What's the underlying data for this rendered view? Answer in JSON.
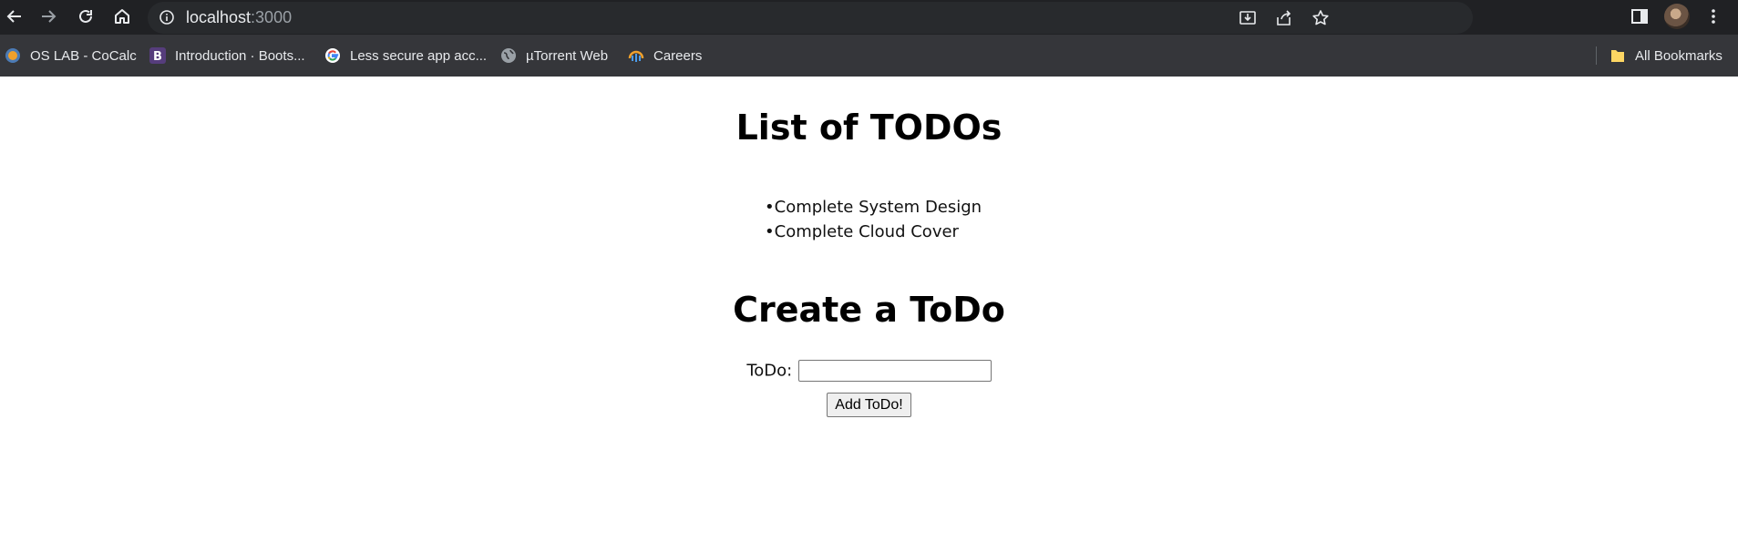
{
  "browser": {
    "url_host": "localhost",
    "url_port": ":3000",
    "bookmarks": [
      {
        "label": "OS LAB - CoCalc",
        "icon": "cocalc-icon"
      },
      {
        "label": "Introduction · Boots...",
        "icon": "bootstrap-icon"
      },
      {
        "label": "Less secure app acc...",
        "icon": "google-icon"
      },
      {
        "label": "µTorrent Web",
        "icon": "globe-icon"
      },
      {
        "label": "Careers",
        "icon": "careers-icon"
      }
    ],
    "all_bookmarks_label": "All Bookmarks"
  },
  "page": {
    "list_title": "List of TODOs",
    "todos": [
      "Complete System Design",
      "Complete Cloud Cover"
    ],
    "form_title": "Create a ToDo",
    "todo_label": "ToDo:",
    "todo_value": "",
    "add_button_label": "Add ToDo!"
  }
}
